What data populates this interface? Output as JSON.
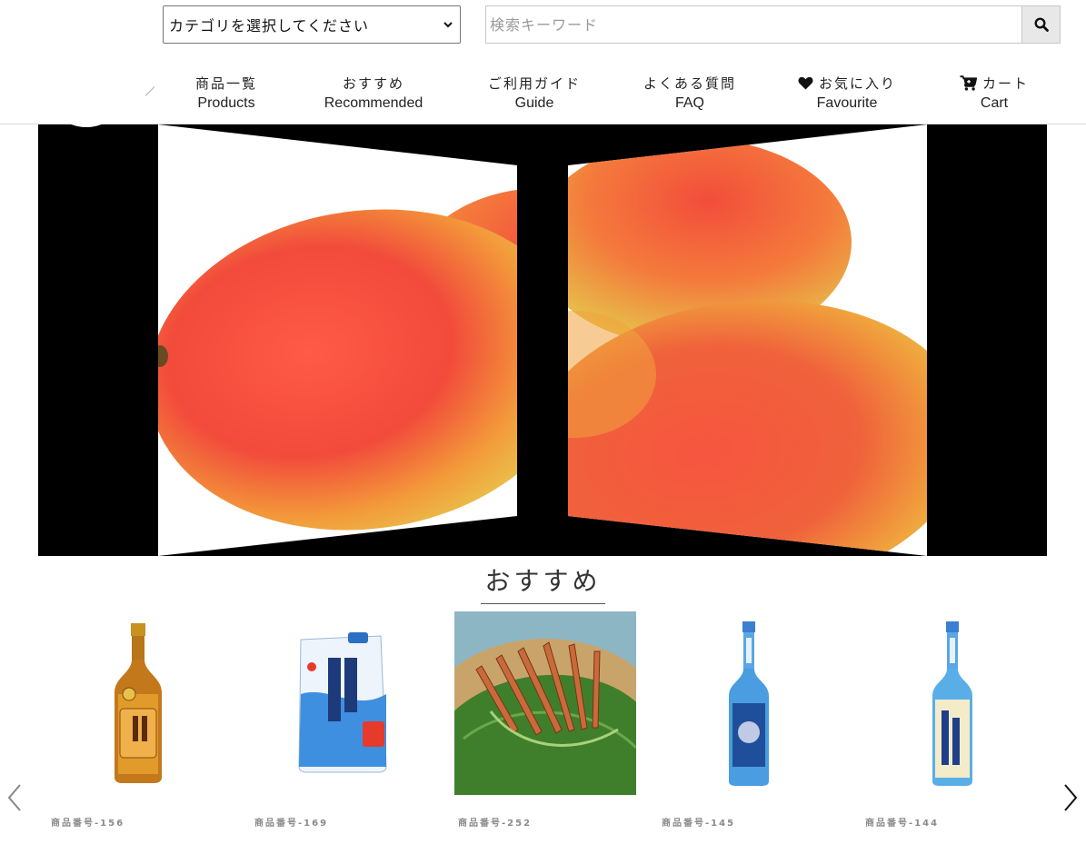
{
  "header": {
    "category_select": {
      "selected": "カテゴリを選択してください"
    },
    "search": {
      "placeholder": "検索キーワード",
      "button_icon": "search-icon"
    },
    "nav": [
      {
        "jp": "商品一覧",
        "en": "Products",
        "icon": ""
      },
      {
        "jp": "おすすめ",
        "en": "Recommended",
        "icon": ""
      },
      {
        "jp": "ご利用ガイド",
        "en": "Guide",
        "icon": ""
      },
      {
        "jp": "よくある質問",
        "en": "FAQ",
        "icon": ""
      },
      {
        "jp": "お気に入り",
        "en": "Favourite",
        "icon": "heart-icon"
      },
      {
        "jp": "カート",
        "en": "Cart",
        "icon": "cart-icon"
      }
    ]
  },
  "hero": {
    "subject": "mango"
  },
  "recommended": {
    "title": "おすすめ",
    "prev_icon": "chevron-left-icon",
    "next_icon": "chevron-right-icon",
    "products": [
      {
        "code": "商品番号-156",
        "kind": "amber-bottle"
      },
      {
        "code": "商品番号-169",
        "kind": "pouch"
      },
      {
        "code": "商品番号-252",
        "kind": "shrimp-photo"
      },
      {
        "code": "商品番号-145",
        "kind": "blue-bottle"
      },
      {
        "code": "商品番号-144",
        "kind": "blue-bottle-label"
      }
    ]
  },
  "colors": {
    "header_border": "#d9d9d9",
    "hero_bg": "#000000",
    "search_button_bg": "#e8e8e8",
    "product_code": "#8a8a8a"
  }
}
